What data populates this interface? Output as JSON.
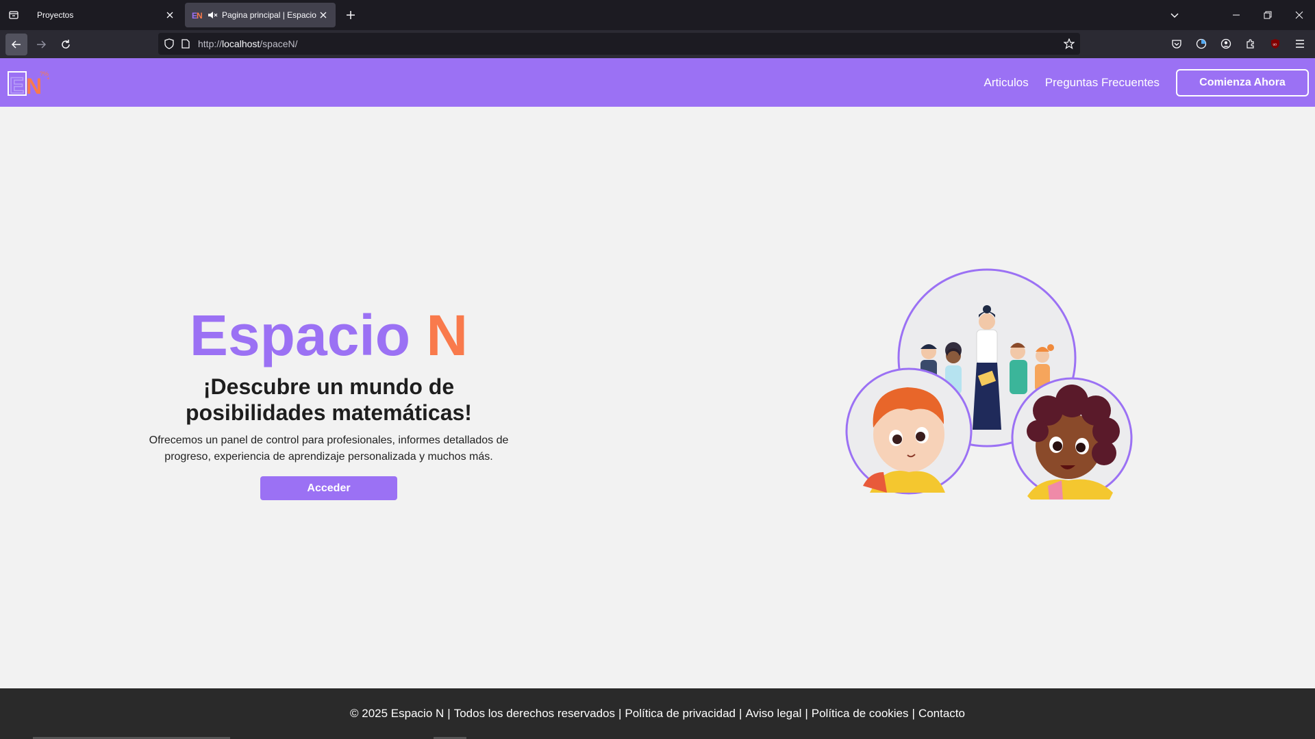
{
  "browser": {
    "tabs": [
      {
        "title": "Proyectos",
        "active": false
      },
      {
        "title": "Pagina principal | Espacio N",
        "active": true
      }
    ],
    "url": {
      "prefix": "http://",
      "host": "localhost",
      "path": "/spaceN/"
    }
  },
  "header": {
    "logo_text": "EN",
    "nav": [
      {
        "label": "Articulos"
      },
      {
        "label": "Preguntas Frecuentes"
      }
    ],
    "cta_label": "Comienza Ahora"
  },
  "hero": {
    "title_main": "Espacio ",
    "title_accent": "N",
    "subtitle": "¡Descubre un mundo de posibilidades matemáticas!",
    "description": "Ofrecemos un panel de control para profesionales, informes detallados de progreso, experiencia de aprendizaje personalizada y muchos más.",
    "button_label": "Acceder"
  },
  "footer": {
    "copyright": "© 2025 Espacio N",
    "links": [
      "Todos los derechos reservados",
      "Política de privacidad",
      "Aviso legal",
      "Política de cookies",
      "Contacto"
    ]
  },
  "colors": {
    "brand_purple": "#9b71f4",
    "brand_orange": "#f97a4c",
    "footer_bg": "#2a2a2a"
  }
}
